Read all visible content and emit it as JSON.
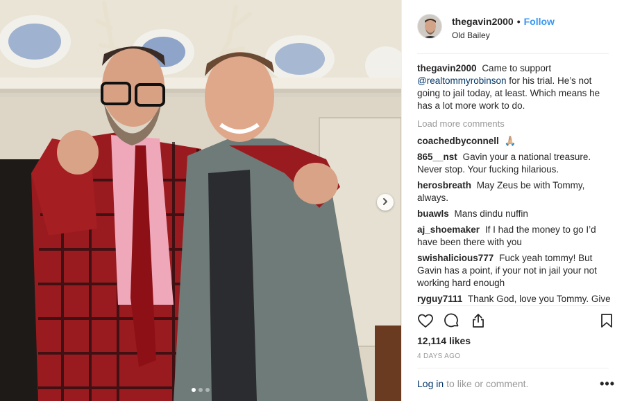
{
  "post": {
    "username": "thegavin2000",
    "follow_label": "Follow",
    "separator": "•",
    "location": "Old Bailey"
  },
  "caption": {
    "username": "thegavin2000",
    "text_before": "Came to support",
    "mention": "@realtommyrobinson",
    "text_after": "for his trial. He’s not going to jail today, at least. Which means he has a lot more work to do."
  },
  "load_more_label": "Load more comments",
  "comments": [
    {
      "user": "coachedbyconnell",
      "text": "🙏🏼"
    },
    {
      "user": "865__nst",
      "text": "Gavin your a national treasure. Never stop. Your fucking hilarious."
    },
    {
      "user": "herosbreath",
      "text": "May Zeus be with Tommy, always."
    },
    {
      "user": "buawls",
      "text": "Mans dindu nuffin"
    },
    {
      "user": "aj_shoemaker",
      "text": "If I had the money to go I’d have been there with you"
    },
    {
      "user": "swishalicious777",
      "text": "Fuck yeah tommy! But Gavin has a point, if your not in jail your not working hard enough"
    },
    {
      "user": "ryguy7111",
      "text": "Thank God, love you Tommy. Give a kiss hug to your kids and wife"
    }
  ],
  "likes": "12,114 likes",
  "time_ago": "4 DAYS AGO",
  "login": {
    "link": "Log in",
    "rest": "to like or comment."
  },
  "more_label": "•••",
  "carousel": {
    "count": 3,
    "active": 0
  },
  "icons": {
    "like": "heart-icon",
    "comment": "comment-bubble-icon",
    "share": "share-icon",
    "save": "bookmark-icon",
    "next": "chevron-right-icon"
  },
  "colors": {
    "accent": "#3897f0",
    "link": "#003569",
    "muted": "#999999",
    "text": "#262626"
  }
}
